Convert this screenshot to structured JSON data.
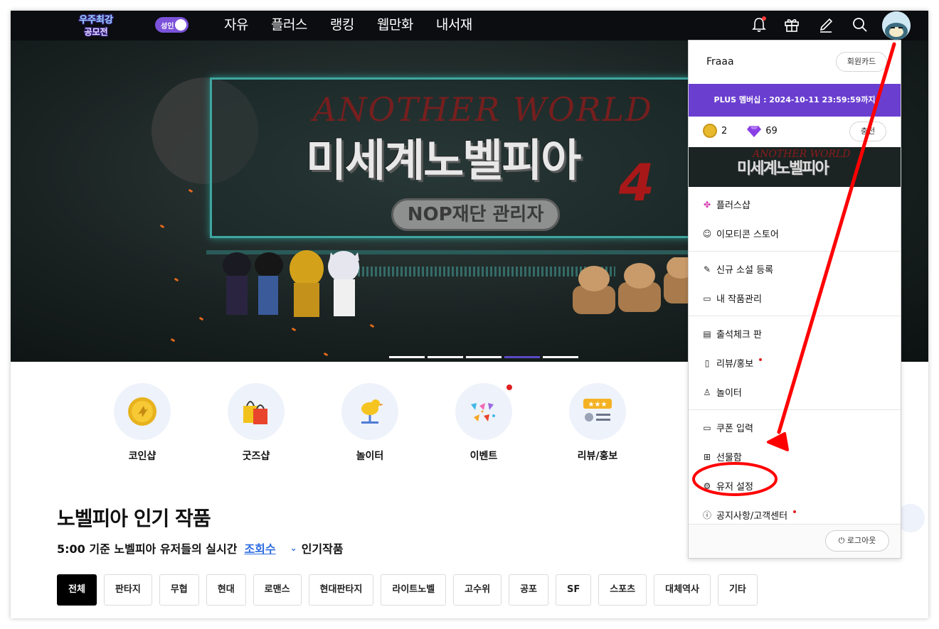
{
  "header": {
    "logo_text": "우주최강 공모전",
    "adult_toggle_label": "성인",
    "nav": [
      "자유",
      "플러스",
      "랭킹",
      "웹만화",
      "내서재"
    ]
  },
  "banner": {
    "subtitle": "ANOTHER WORLD",
    "title": "미세계노벨피아",
    "number": "4",
    "pill": "NOP재단 관리자",
    "slides_total": 5,
    "slide_active_index": 4
  },
  "quick": [
    {
      "label": "코인샵",
      "icon": "coin-shop-icon",
      "dot": false
    },
    {
      "label": "굿즈샵",
      "icon": "shopping-bag-icon",
      "dot": false
    },
    {
      "label": "놀이터",
      "icon": "playground-icon",
      "dot": false
    },
    {
      "label": "이벤트",
      "icon": "confetti-icon",
      "dot": true
    },
    {
      "label": "리뷰/홍보",
      "icon": "review-icon",
      "dot": false
    }
  ],
  "section": {
    "title": "노벨피아 인기 작품",
    "sub_prefix": "5:00 기준 노벨피아 유저들의 실시간",
    "sub_link": "조회수",
    "sub_suffix": "인기작품",
    "genres": [
      "전체",
      "판타지",
      "무협",
      "현대",
      "로맨스",
      "현대판타지",
      "라이트노벨",
      "고수위",
      "공포",
      "SF",
      "스포츠",
      "대체역사",
      "기타"
    ]
  },
  "dropdown": {
    "username": "Fraaa",
    "member_card": "회원카드",
    "plus_membership": "PLUS 멤버십 : 2024-10-11 23:59:59까지",
    "coins": "2",
    "gems": "69",
    "charge_label": "충전",
    "promo_title": "미세계노벨피아",
    "promo_subtitle": "ANOTHER WORLD",
    "groups": [
      [
        {
          "label": "플러스샵",
          "icon": "clover-icon",
          "dot": false
        },
        {
          "label": "이모티콘 스토어",
          "icon": "emoticon-icon",
          "dot": false
        }
      ],
      [
        {
          "label": "신규 소설 등록",
          "icon": "pen-icon",
          "dot": false
        },
        {
          "label": "내 작품관리",
          "icon": "folder-icon",
          "dot": false
        }
      ],
      [
        {
          "label": "출석체크 판",
          "icon": "calendar-icon",
          "dot": false
        },
        {
          "label": "리뷰/홍보",
          "icon": "document-icon",
          "dot": true
        },
        {
          "label": "놀이터",
          "icon": "playground-icon",
          "dot": false
        }
      ],
      [
        {
          "label": "쿠폰 입력",
          "icon": "ticket-icon",
          "dot": false
        },
        {
          "label": "선물함",
          "icon": "gift-icon",
          "dot": false
        },
        {
          "label": "유저 설정",
          "icon": "settings-icon",
          "dot": false
        },
        {
          "label": "공지사항/고객센터",
          "icon": "info-icon",
          "dot": true
        }
      ]
    ],
    "logout": "로그아웃"
  },
  "colors": {
    "accent": "#6a3fd0",
    "header_bg": "#0b0d10",
    "annotation": "#ff0000",
    "link": "#2d6be0"
  }
}
